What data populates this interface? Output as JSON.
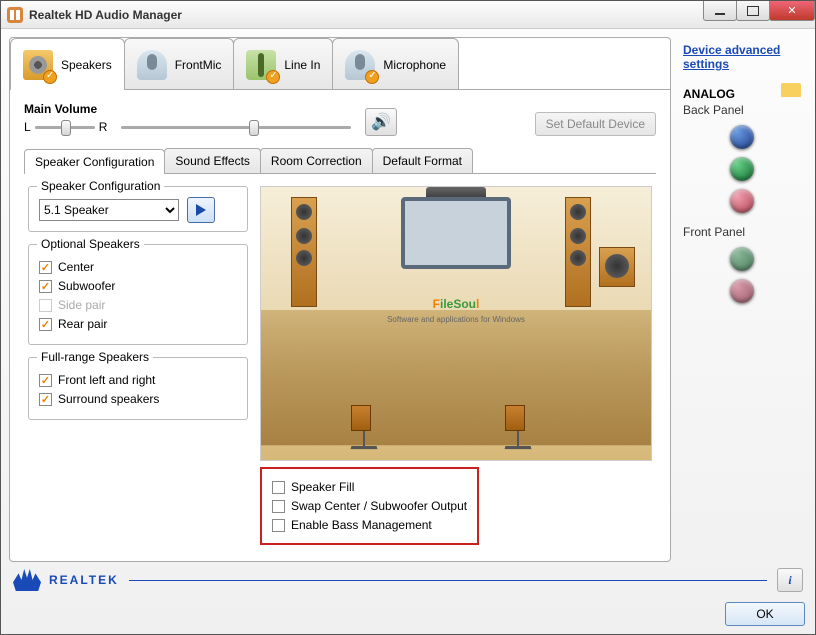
{
  "titlebar": {
    "title": "Realtek HD Audio Manager"
  },
  "devtabs": {
    "speakers": "Speakers",
    "frontmic": "FrontMic",
    "linein": "Line In",
    "microphone": "Microphone"
  },
  "mainvol": {
    "label": "Main Volume",
    "L": "L",
    "R": "R"
  },
  "defbtn": "Set Default Device",
  "subtabs": {
    "config": "Speaker Configuration",
    "effects": "Sound Effects",
    "room": "Room Correction",
    "format": "Default Format"
  },
  "spkconfig": {
    "label": "Speaker Configuration",
    "selected": "5.1 Speaker"
  },
  "optional": {
    "label": "Optional Speakers",
    "center": "Center",
    "sub": "Subwoofer",
    "side": "Side pair",
    "rear": "Rear pair"
  },
  "fullrange": {
    "label": "Full-range Speakers",
    "front": "Front left and right",
    "surround": "Surround speakers"
  },
  "redbox": {
    "fill": "Speaker Fill",
    "swap": "Swap Center / Subwoofer Output",
    "bass": "Enable Bass Management"
  },
  "watermark": {
    "text": "FileSoul",
    "sub": "Software and applications for Windows"
  },
  "side": {
    "advlink": "Device advanced settings",
    "analog": "ANALOG",
    "back": "Back Panel",
    "front": "Front Panel"
  },
  "footer": {
    "brand": "REALTEK",
    "ok": "OK"
  }
}
